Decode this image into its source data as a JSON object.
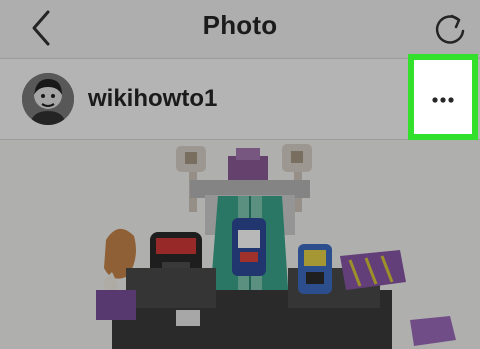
{
  "navbar": {
    "title": "Photo",
    "back_icon": "chevron-left-icon",
    "refresh_icon": "refresh-icon"
  },
  "post": {
    "username": "wikihowto1",
    "more_icon": "more-horizontal-icon",
    "highlight_color": "#33e02c"
  },
  "photo": {
    "subject": "toy-vehicle-playset"
  }
}
